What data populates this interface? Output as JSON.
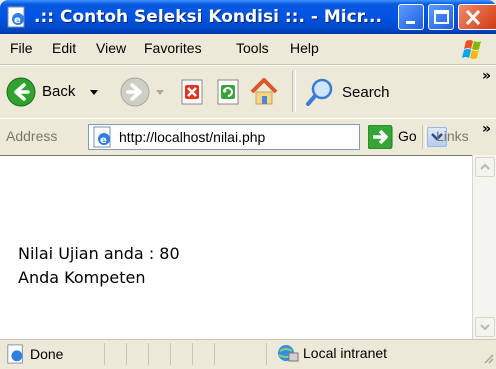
{
  "window": {
    "title": ".:: Contoh Seleksi Kondisi ::. - Micr...",
    "title_color": "#0054e3",
    "close_color": "#d03a10"
  },
  "menu": {
    "items": [
      "File",
      "Edit",
      "View",
      "Favorites",
      "Tools",
      "Help"
    ]
  },
  "toolbar": {
    "back_label": "Back",
    "search_label": "Search",
    "overflow_glyph": "»"
  },
  "address": {
    "label": "Address",
    "url": "http://localhost/nilai.php",
    "go_label": "Go",
    "links_label": "Links",
    "overflow_glyph": "»"
  },
  "content": {
    "lines": [
      "Nilai Ujian anda : 80",
      "Anda Kompeten"
    ]
  },
  "status": {
    "text": "Done",
    "zone": "Local intranet"
  },
  "icons": [
    "ie-page-icon",
    "minimize-icon",
    "maximize-icon",
    "close-icon",
    "windows-logo-icon",
    "back-arrow-icon",
    "forward-arrow-icon",
    "stop-icon",
    "refresh-icon",
    "home-icon",
    "search-icon",
    "go-arrow-icon",
    "local-intranet-icon",
    "resize-grip-icon"
  ]
}
